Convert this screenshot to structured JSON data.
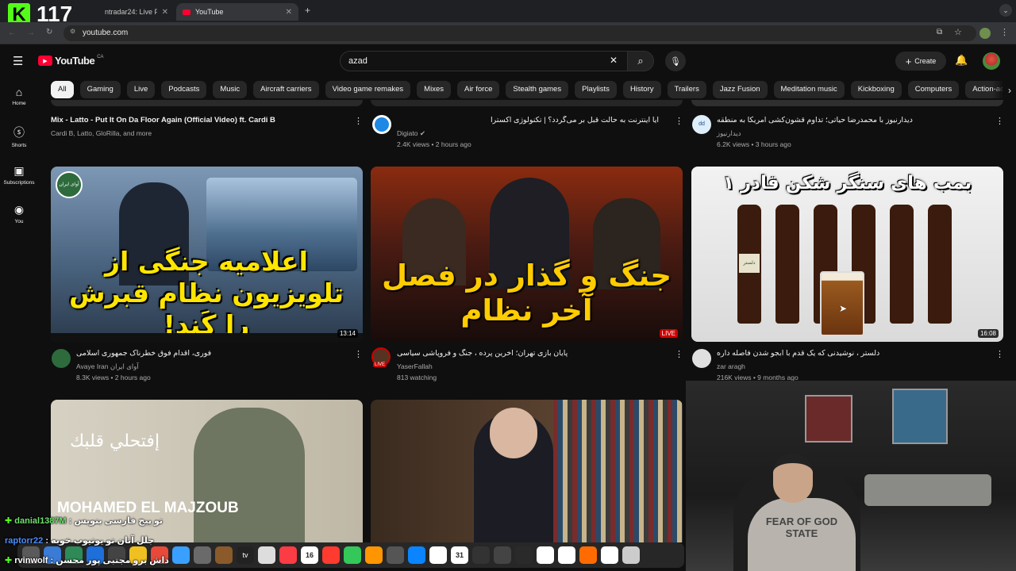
{
  "overlay": {
    "counter": "117"
  },
  "browser": {
    "tabs": [
      {
        "label": "ntradar24: Live Flight Tra"
      },
      {
        "label": "YouTube"
      }
    ],
    "url": "youtube.com"
  },
  "youtube": {
    "logo": "YouTube",
    "region": "CA",
    "search_value": "azad",
    "create_label": "Create",
    "chips": [
      "All",
      "Gaming",
      "Live",
      "Podcasts",
      "Music",
      "Aircraft carriers",
      "Video game remakes",
      "Mixes",
      "Air force",
      "Stealth games",
      "Playlists",
      "History",
      "Trailers",
      "Jazz Fusion",
      "Meditation music",
      "Kickboxing",
      "Computers",
      "Action-advent"
    ],
    "sidebar": [
      {
        "label": "Home",
        "icon": "home-icon"
      },
      {
        "label": "Shorts",
        "icon": "shorts-icon"
      },
      {
        "label": "Subscriptions",
        "icon": "subscriptions-icon"
      },
      {
        "label": "You",
        "icon": "you-icon"
      }
    ],
    "videos": [
      {
        "title": "Mix - Latto - Put It On Da Floor Again (Official Video) ft. Cardi B",
        "channel": "Cardi B, Latto, GloRilla, and more",
        "meta": ""
      },
      {
        "title": "آیا اینترنت به حالت قبل بر می‌گردد؟ | تکنولوژی اکسترا",
        "channel": "Digiato",
        "meta": "2.4K views • 2 hours ago"
      },
      {
        "title": "دیدارنیوز با محمدرضا حیاتی؛ تداوم قشون‌کشی آمریکا به منطقه",
        "channel": "دیدارنیوز",
        "meta": "6.2K views • 3 hours ago"
      },
      {
        "title": "فوری، اقدام فوق خطرناک جمهوری اسلامی",
        "channel": "Avaye Iran آوای ایران",
        "meta": "8.3K views • 2 hours ago",
        "duration": "13:14",
        "thumb_text": "اعلامیه جنگی از تلویزیون نظام قبرش را کَند!",
        "thumb_badge": "آوای ایران"
      },
      {
        "title": "پایان بازی تهران؛ آخرین پرده ، جنگ و فروپاشی سیاسی",
        "channel": "YaserFallah",
        "meta": "813 watching",
        "duration": "LIVE",
        "thumb_text": "جنگ و گذار در فصل آخر نظام",
        "avatar_live": "LIVE"
      },
      {
        "title": "دلستر ، نوشیدنی که یک قدم با آبجو شدن فاصله داره",
        "channel": "zar aragh",
        "meta": "216K views • 9 months ago",
        "duration": "16:08",
        "thumb_text": "بمب های سنگر شکن قادر ۱",
        "bottle_label": "دلستر"
      },
      {
        "title": "",
        "channel": "",
        "meta": "",
        "thumb_text": "MOHAMED EL MAJZOUB",
        "thumb_arabic": "إفتحلي قلبك"
      },
      {
        "title": "",
        "channel": "",
        "meta": ""
      }
    ]
  },
  "stream_chat": [
    {
      "user": "danial1387M",
      "message": "تو پیج فارسی بنویس",
      "color": "#6fe06f"
    },
    {
      "user": "raptorr22",
      "message": "جلل آتان تو یوتیوب خوبه",
      "color": "#4d8dff"
    },
    {
      "user": "rvinwolf",
      "message": "داش برو مجتبی پور محسن",
      "color": "#ffffff"
    }
  ],
  "webcam": {
    "shirt_text": "FEAR OF GOD\nSTATE"
  },
  "dock": {
    "calendar_date": "16",
    "calendar_day": "31",
    "tv_label": "tv"
  }
}
